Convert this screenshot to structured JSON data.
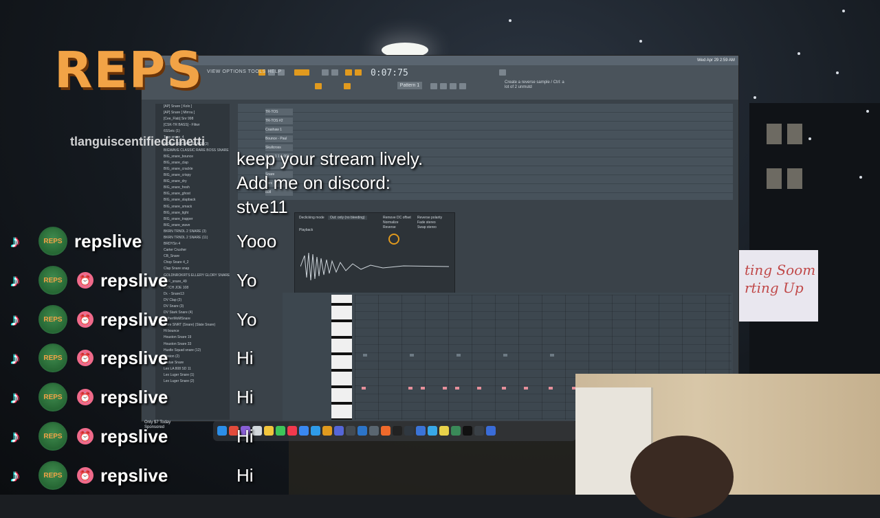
{
  "logo": {
    "text": "REPS"
  },
  "fl_studio": {
    "menu": "VIEW OPTIONS TOOLS HELP",
    "time_display": "0:07:75",
    "pattern_label": "Pattern 1",
    "status_hint": "Create a reverse sample / Ctrl: a lot of 2 unmutd",
    "macos_datetime": "Wed Apr 29 2:59 AM",
    "browser_items": [
      "[AP] Snare [ Kolo ]",
      "[AP] Snare [ Mirrou ]",
      "[Cee_Flab] Snr 998",
      "[CSK-TR BASS] - Flitwr",
      "6SSetc (1)",
      "Trap snare_4",
      "BIG NOTE CLAP_SKAKE (2)",
      "BIGWAVE CLASSIC RARE BOSS SNARE 3_2",
      "BIG_snare_bounce",
      "BIG_snare_clap",
      "BIG_snare_crackle",
      "BIG_snare_crispy",
      "BIG_snare_dry",
      "BIG_snare_fresh",
      "BIG_snare_ghost",
      "BIG_snare_slapback",
      "BIG_snare_smack",
      "BIG_snare_tight",
      "BIG_snare_trapper",
      "BIG_snare_wave",
      "BKRN TRNDL 2 SNARE (3)",
      "BKRN TRNDL 2 SNARE (11)",
      "BRDYSn 4",
      "Carter Crusher",
      "CB_Snare",
      "Chop Snare 4_2",
      "Clap Snare snap",
      "GOLDNROKRTS ELLERY GLORY SNARE 14",
      "DEF_snare_49",
      "DITCH JOE 108",
      "Dr. - Snare13",
      "DV Clap (2)",
      "DV Snare (3)",
      "DV Stark Snare (4)",
      "FatherMoMSnare",
      "Flare SNRT (Snare) (Slate Snare)",
      "Hi bounce",
      "Houston Snare 19",
      "Houston Snare 33",
      "Hustle Squad snare (12)",
      "Illusion (2)",
      "Kadue Snare",
      "Lex LA 808 SD 11",
      "Lex Luger Snare (1)",
      "Lex Luger Snare (2)"
    ],
    "channels": [
      "TR-TOS",
      "TR-TOS #2",
      "Crashaw 1",
      "Bounce - Paul",
      "Skullcross",
      "Mario 1 1 1 001",
      "Hat 1",
      "Snare",
      "Perc",
      "808"
    ],
    "sampler": {
      "declick_label": "Declicking mode",
      "declick_value": "Out: only (no bleeding)",
      "section": "Playback",
      "options": [
        "Remove DC offset",
        "Normalize",
        "Reverse",
        "Reverse polarity",
        "Fade stereo",
        "Swap stereo"
      ]
    },
    "ad": {
      "line1": "Only $7 Today",
      "line2": "Sponsored"
    }
  },
  "stream_overlay": {
    "line1": "keep your stream lively.",
    "line2": "Add me on discord:",
    "line3": "stve11"
  },
  "chat": {
    "top_username": "tlanguiscentifiedcinetti",
    "messages": [
      {
        "username": "repslive",
        "text": "Yooo",
        "badge": false
      },
      {
        "username": "repslive",
        "text": "Yo",
        "badge": true
      },
      {
        "username": "repslive",
        "text": "Yo",
        "badge": true
      },
      {
        "username": "repslive",
        "text": "Hi",
        "badge": true
      },
      {
        "username": "repslive",
        "text": "Hi",
        "badge": true
      },
      {
        "username": "repslive",
        "text": "Hi",
        "badge": true
      },
      {
        "username": "repslive",
        "text": "Hi",
        "badge": true
      }
    ]
  },
  "sign": {
    "line1": "ting Soom",
    "line2": "rting Up"
  },
  "colors": {
    "accent": "#e19a1e",
    "note": "#e68f9a",
    "tiktok_cyan": "#25f4ee",
    "tiktok_red": "#fe2c55"
  }
}
